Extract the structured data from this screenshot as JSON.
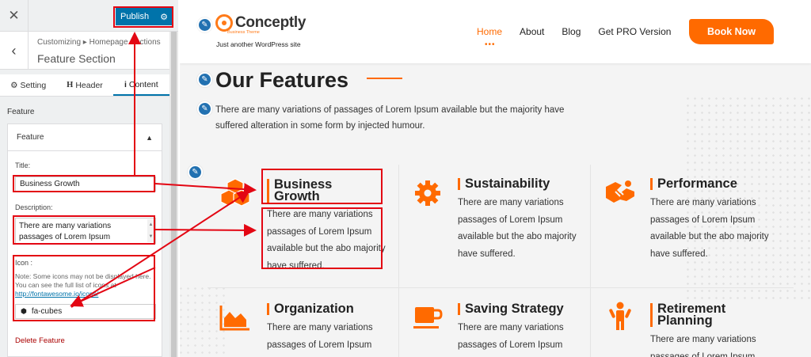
{
  "sidebar": {
    "close_icon": "close-icon",
    "publish_label": "Publish",
    "breadcrumb": "Customizing ▸ Homepage Sections",
    "section_title": "Feature Section",
    "tabs": [
      {
        "label": "Setting",
        "icon": "gears-icon"
      },
      {
        "label": "Header",
        "icon": "header-icon"
      },
      {
        "label": "Content",
        "icon": "info-icon"
      }
    ],
    "group_label": "Feature",
    "panel_title": "Feature",
    "title_label": "Title:",
    "title_value": "Business Growth",
    "description_label": "Description:",
    "description_value": "There are many variations passages of Lorem Ipsum",
    "icon_label": "Icon :",
    "icon_note": "Note: Some icons may not be displayed here. You can see the full list of icons at",
    "icon_link": "http://fontawesome.io/icons/",
    "icon_value": "fa-cubes",
    "delete_label": "Delete Feature"
  },
  "site": {
    "logo_name": "Conceptly",
    "logo_sub": "Business Theme",
    "tagline": "Just another WordPress site",
    "nav": [
      "Home",
      "About",
      "Blog",
      "Get PRO Version"
    ],
    "nav_active": "Home",
    "nav_dots": "•••",
    "book_label": "Book Now",
    "accent": "#ff6a00"
  },
  "features": {
    "title": "Our Features",
    "description": "There are many variations of passages of Lorem Ipsum available but the majority have suffered alteration in some form by injected humour.",
    "items": [
      {
        "title": "Business Growth",
        "desc": "There are many variations passages of Lorem Ipsum available but the abo majority have suffered.",
        "icon": "cubes-icon"
      },
      {
        "title": "Sustainability",
        "desc": "There are many variations passages of Lorem Ipsum available but the abo majority have suffered.",
        "icon": "cog-icon"
      },
      {
        "title": "Performance",
        "desc": "There are many variations passages of Lorem Ipsum available but the abo majority have suffered.",
        "icon": "handshake-icon"
      },
      {
        "title": "Organization",
        "desc": "There are many variations passages of Lorem Ipsum",
        "icon": "area-chart-icon"
      },
      {
        "title": "Saving Strategy",
        "desc": "There are many variations passages of Lorem Ipsum",
        "icon": "coffee-cup-icon"
      },
      {
        "title": "Retirement Planning",
        "desc": "There are many variations passages of Lorem Ipsum",
        "icon": "person-icon"
      }
    ]
  }
}
